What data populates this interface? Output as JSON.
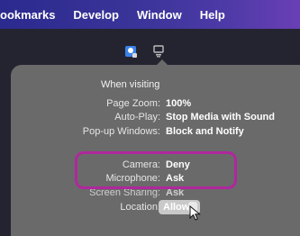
{
  "menubar": {
    "items": [
      "ookmarks",
      "Develop",
      "Window",
      "Help"
    ]
  },
  "icons": {
    "site": "website-settings-icon",
    "prefs": "preferences-icon",
    "cursor": "mouse-pointer-icon"
  },
  "panel": {
    "heading": "When visiting",
    "rows": [
      {
        "label": "Page Zoom:",
        "value": "100%"
      },
      {
        "label": "Auto-Play:",
        "value": "Stop Media with Sound"
      },
      {
        "label": "Pop-up Windows:",
        "value": "Block and Notify"
      },
      {
        "label": "Camera:",
        "value": "Deny"
      },
      {
        "label": "Microphone:",
        "value": "Ask"
      },
      {
        "label": "Screen Sharing:",
        "value": "Ask"
      },
      {
        "label": "Location:",
        "value": "Allow"
      }
    ]
  },
  "colors": {
    "highlight": "#b0279d",
    "menubar_start": "#2b2a8e",
    "menubar_end": "#6a3fb5",
    "panel": "#6a6a6a"
  }
}
